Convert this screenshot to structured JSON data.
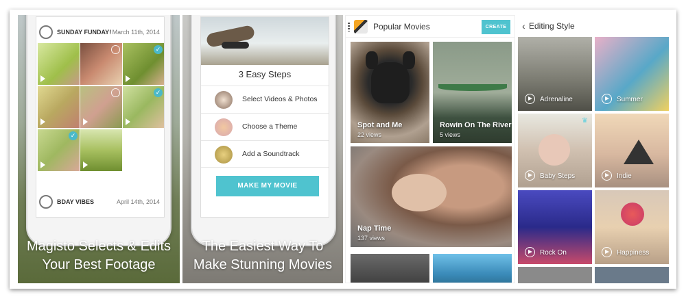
{
  "panel1": {
    "caption_line1": "Magisto Selects & Edits",
    "caption_line2": "Your Best Footage",
    "albums": [
      {
        "title": "SUNDAY FUNDAY!",
        "date": "March 11th, 2014"
      },
      {
        "title": "BDAY VIBES",
        "date": "April 14th, 2014"
      }
    ]
  },
  "panel2": {
    "caption_line1": "The Easiest Way To",
    "caption_line2": "Make Stunning Movies",
    "steps_title": "3 Easy Steps",
    "steps": [
      "Select Videos & Photos",
      "Choose a Theme",
      "Add a Soundtrack"
    ],
    "make_button": "MAKE MY MOVIE"
  },
  "panel3": {
    "title": "Popular Movies",
    "create_button": "CREATE",
    "movies": [
      {
        "title": "Spot and Me",
        "views": "22 views"
      },
      {
        "title": "Rowin On The River",
        "views": "5 views"
      },
      {
        "title": "Nap Time",
        "views": "137 views"
      }
    ]
  },
  "panel4": {
    "title": "Editing Style",
    "styles": [
      "Adrenaline",
      "Summer",
      "Baby Steps",
      "Indie",
      "Rock On",
      "Happiness"
    ]
  },
  "colors": {
    "accent": "#4fc3cf",
    "check": "#4ab9c9"
  },
  "icons": [
    "menu-icon",
    "app-logo",
    "chevron-left-icon",
    "play-icon",
    "check-icon",
    "crown-icon"
  ]
}
